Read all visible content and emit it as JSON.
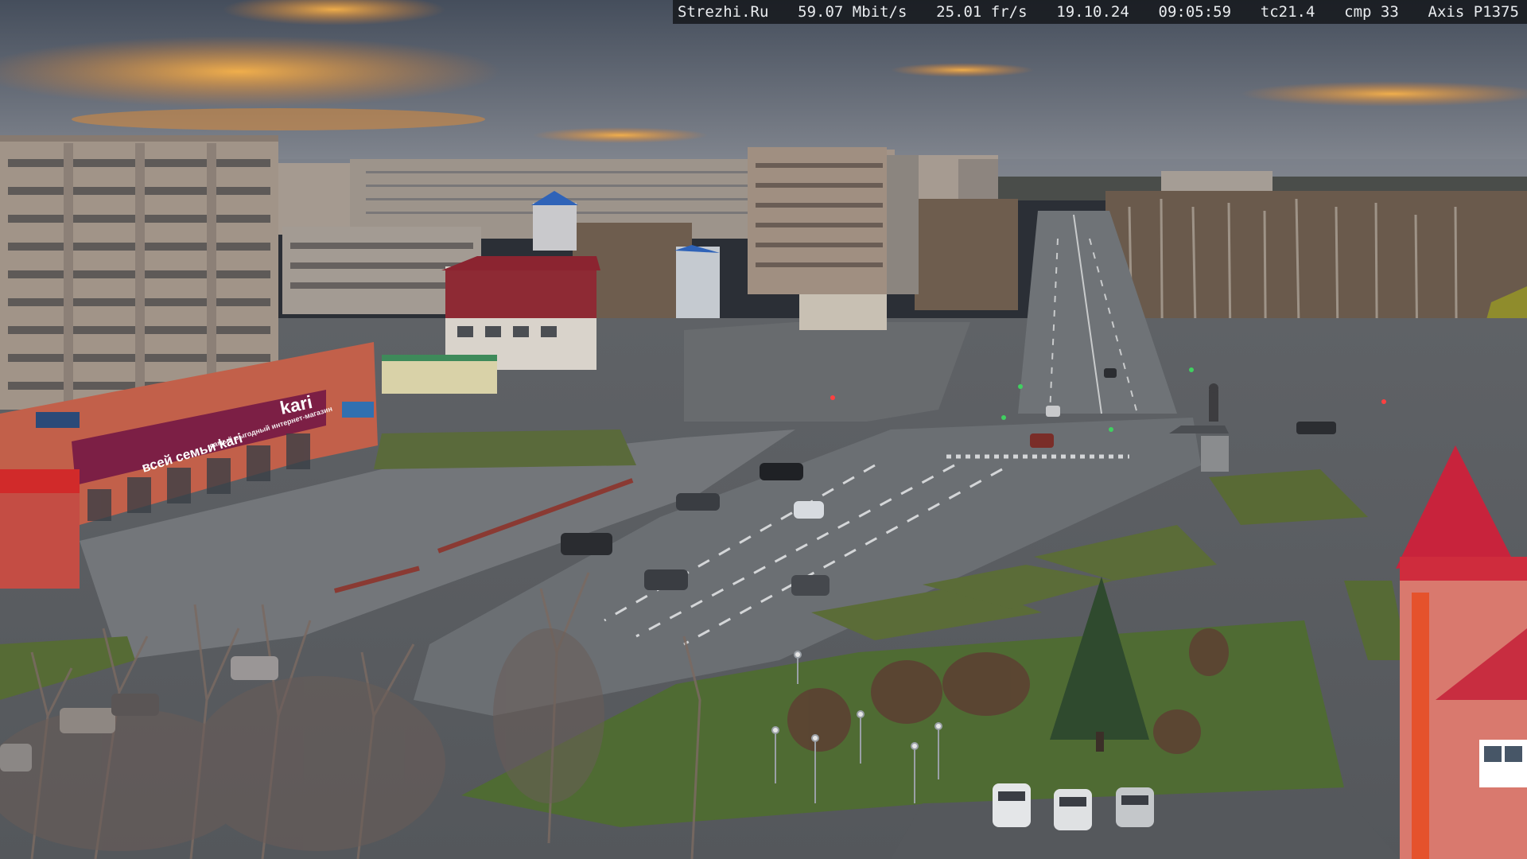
{
  "camera_overlay": {
    "site": "Strezhi.Ru",
    "bitrate": "59.07 Mbit/s",
    "framerate": "25.01 fr/s",
    "date": "19.10.24",
    "time": "09:05:59",
    "tc": "tc21.4",
    "cmp": "cmp 33",
    "model": "Axis P1375"
  },
  "storefront": {
    "brand": "kari",
    "banner_left": "всей семьи kari",
    "banner_mid": "самый выгодный интернет-магазин"
  },
  "colors": {
    "sky_top": "#4a5566",
    "sky_glow": "#e79a3c",
    "storefront": "#7c1f45",
    "grass": "#5f7a3a",
    "asphalt": "#6e7276"
  }
}
